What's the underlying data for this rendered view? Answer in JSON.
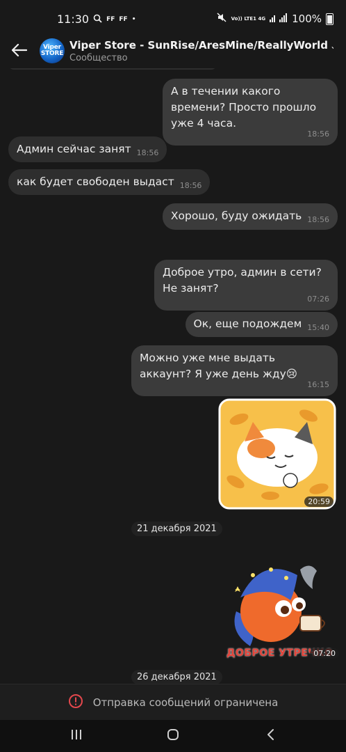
{
  "status_bar": {
    "time": "11:30",
    "indicators": [
      "FF",
      "FF",
      "•"
    ],
    "network": "Vo)) LTE1 4G",
    "battery_text": "100%"
  },
  "header": {
    "title": "Viper Store - SunRise/AresMine/ReallyWorld",
    "subtitle": "Сообщество",
    "avatar_text": "Viper STORE"
  },
  "messages": [
    {
      "dir": "out",
      "text": "А в течении какого времени? Просто прошло уже 4 часа.",
      "time": "18:56"
    },
    {
      "dir": "in",
      "text": "Админ сейчас занят",
      "time": "18:56"
    },
    {
      "dir": "in",
      "text": "как будет свободен выдаст",
      "time": "18:56"
    },
    {
      "dir": "out",
      "text": "Хорошо, буду ожидать",
      "time": "18:56"
    },
    {
      "dir": "out",
      "text": "Доброе утро, админ в сети? Не занят?",
      "time": "07:26"
    },
    {
      "dir": "out",
      "text": "Ок, еще подождем",
      "time": "15:40"
    },
    {
      "dir": "out",
      "text": "Можно уже мне выдать аккаунт? Я уже день жду😢",
      "time": "16:15"
    },
    {
      "dir": "out",
      "sticker": "sleepy-cat-sticker",
      "time": "20:59"
    },
    {
      "date": "21 декабря 2021"
    },
    {
      "dir": "out",
      "sticker": "good-morning-ball-sticker",
      "sticker_text": "ДОБРОЕ УТРЕЧКО",
      "time": "07:20"
    },
    {
      "date": "26 декабря 2021"
    }
  ],
  "restriction": {
    "icon": "alert-circle-icon",
    "text": "Отправка сообщений ограничена"
  },
  "nav": {
    "recents_icon": "recents-icon",
    "home_icon": "home-icon",
    "back_icon": "back-icon"
  },
  "colors": {
    "background": "#191919",
    "bubble_in": "#2e2e2e",
    "bubble_out": "#3b3b3b",
    "alert": "#e5484d"
  }
}
